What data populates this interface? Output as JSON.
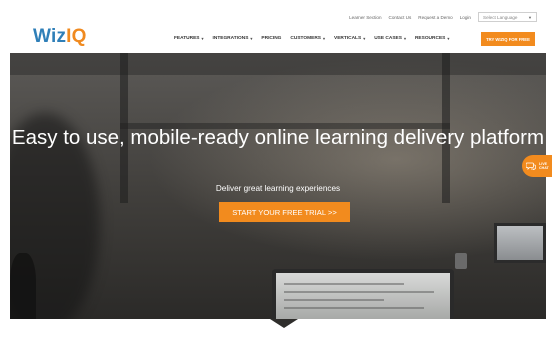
{
  "header": {
    "logo": {
      "part1": "Wiz",
      "part2": "IQ"
    },
    "top_links": [
      "Learner Section",
      "Contact Us",
      "Request a Demo",
      "Login"
    ],
    "language_select": {
      "value": "Select Language"
    },
    "nav": [
      {
        "label": "FEATURES",
        "dropdown": true
      },
      {
        "label": "INTEGRATIONS",
        "dropdown": true
      },
      {
        "label": "PRICING",
        "dropdown": false
      },
      {
        "label": "CUSTOMERS",
        "dropdown": true
      },
      {
        "label": "VERTICALS",
        "dropdown": true
      },
      {
        "label": "USE CASES",
        "dropdown": true
      },
      {
        "label": "RESOURCES",
        "dropdown": true
      }
    ],
    "try_button": "TRY WIZIQ FOR FREE"
  },
  "hero": {
    "title": "Easy to use, mobile-ready online learning delivery platform",
    "subtitle": "Deliver great learning experiences",
    "cta": "START YOUR FREE TRIAL >>"
  },
  "chat": {
    "label": "LIVE\nCHAT"
  },
  "colors": {
    "accent": "#f28b1e",
    "brand_blue": "#2f7fb8"
  }
}
